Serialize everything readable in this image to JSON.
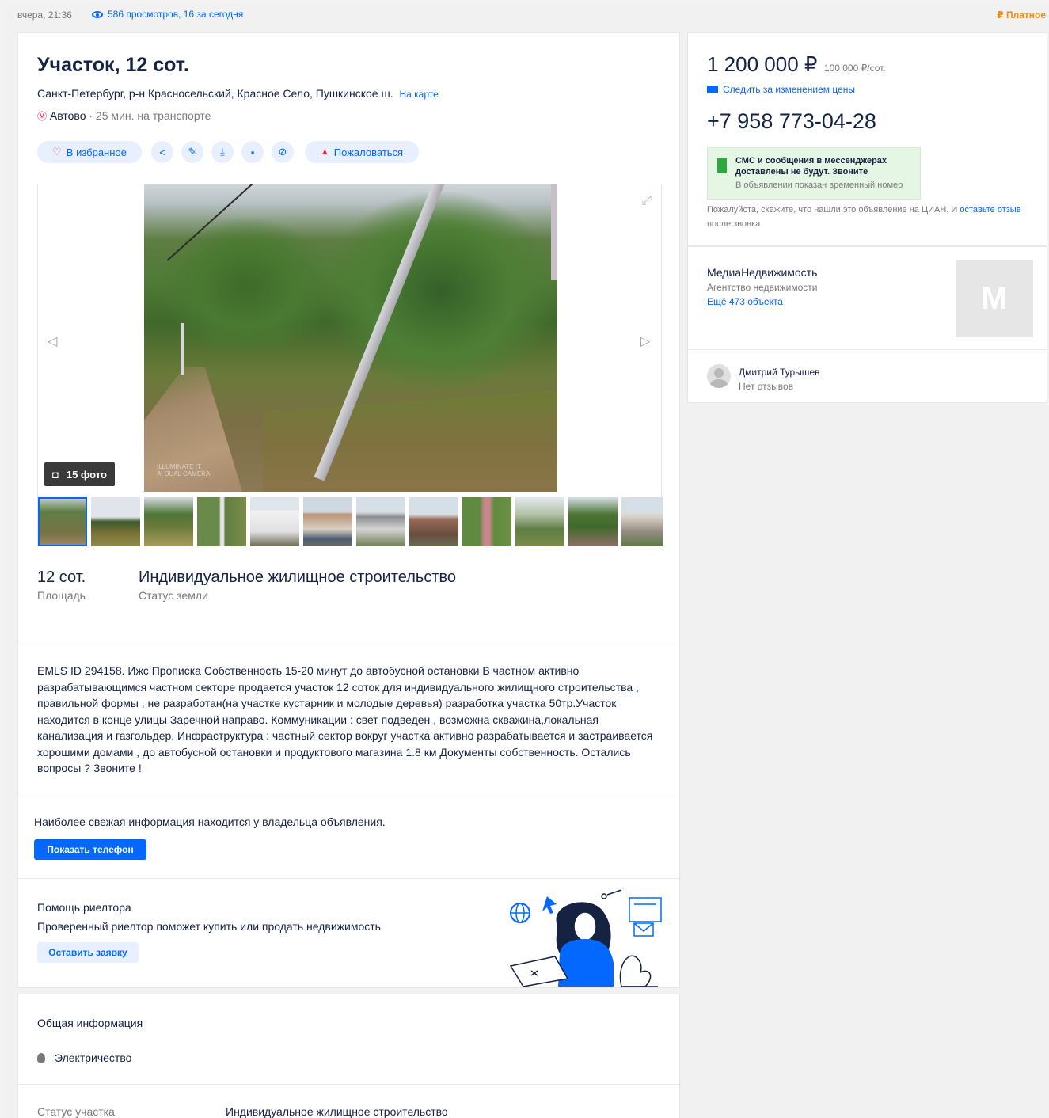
{
  "top": {
    "date": "вчера, 21:36",
    "views": "586 просмотров, 16 за сегодня",
    "paid": "Платное",
    "paid_icon": "₽"
  },
  "listing": {
    "title": "Участок, 12 сот.",
    "address": "Санкт-Петербург, р-н Красносельский, Красное Село, Пушкинское ш.",
    "map_link": "На карте",
    "metro_icon": "Ⓜ",
    "metro": "Автово",
    "metro_time": "· 25 мин. на транспорте"
  },
  "actions": {
    "favorite": "В избранное",
    "report": "Пожаловаться"
  },
  "gallery": {
    "photos_count": "15 фото",
    "watermark_line1": "ILLUMINATE IT",
    "watermark_line2": "AI DUAL CAMERA"
  },
  "facts": [
    {
      "value": "12 сот.",
      "label": "Площадь"
    },
    {
      "value": "Индивидуальное жилищное строительство",
      "label": "Статус земли"
    }
  ],
  "description": "EMLS ID 294158. Ижс Прописка Собственность 15-20 минут до автобусной остановки В частном активно разрабатывающимся частном секторе продается участок 12 соток для индивидуального жилищного строительства , правильной формы , не разработан(на участке кустарник и молодые деревья) разработка участка 50тр.Участок находится в конце улицы Заречной направо. Коммуникации : свет подведен , возможна скважина,локальная канализация и газгольдер. Инфраструктура : частный сектор вокруг участка активно разрабатывается и застраивается хорошими домами , до автобусной остановки и продуктового магазина 1.8 км Документы собственность. Остались вопросы ? Звоните !",
  "owner_info": {
    "text": "Наиболее свежая информация находится у владельца объявления.",
    "button": "Показать телефон"
  },
  "realtor": {
    "title": "Помощь риелтора",
    "subtitle": "Проверенный риелтор поможет купить или продать недвижимость",
    "button": "Оставить заявку"
  },
  "general": {
    "title": "Общая информация",
    "items": [
      "Электричество"
    ],
    "status_label": "Статус участка",
    "status_value": "Индивидуальное жилищное строительство"
  },
  "sidebar": {
    "price": "1 200 000 ₽",
    "price_per": "100 000 ₽/сот.",
    "follow_price": "Следить за изменением цены",
    "phone": "+7 958 773-04-28",
    "notice_line1": "СМС и сообщения в мессенджерах",
    "notice_line2": "доставлены не будут. Звоните",
    "notice_line3": "В объявлении показан временный номер",
    "hint_text": "Пожалуйста, скажите, что нашли это объявление на ЦИАН. И ",
    "hint_link": "оставьте отзыв",
    "hint_tail": " после звонка",
    "agency_name": "МедиаНедвижимость",
    "agency_type": "Агентство недвижимости",
    "agency_more": "Ещё 473 объекта",
    "agency_logo_letter": "M",
    "agent_name": "Дмитрий Турышев",
    "agent_reviews": "Нет отзывов"
  },
  "colors": {
    "accent": "#0468ff",
    "paid": "#ff8a00",
    "report": "#ff1f34",
    "favorite": "#ff5574"
  }
}
